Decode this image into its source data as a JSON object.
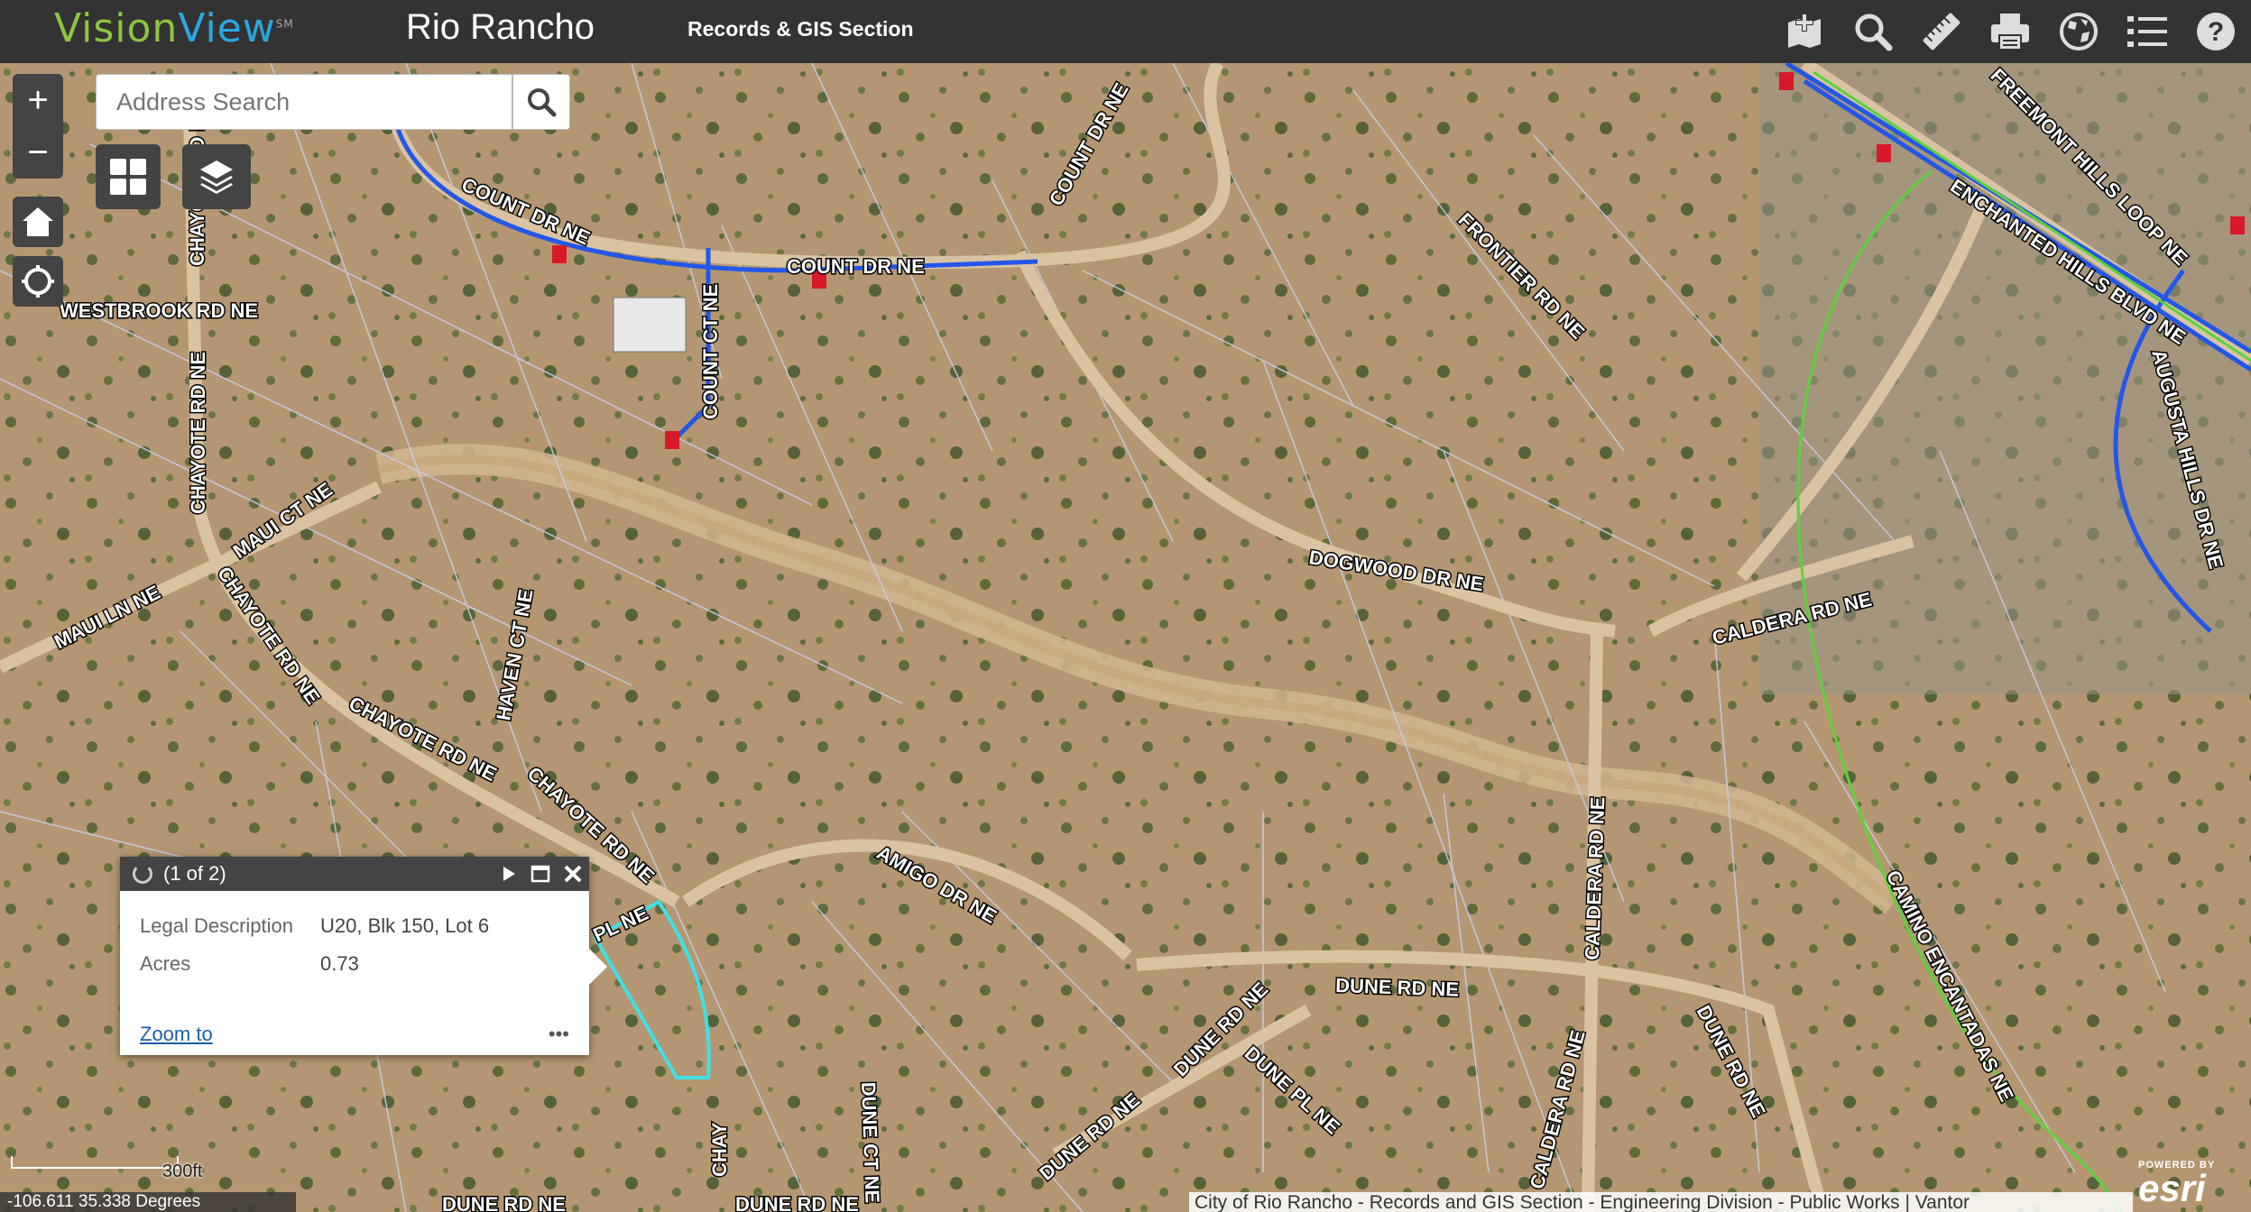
{
  "header": {
    "logo_vision": "Vision",
    "logo_view": "View",
    "logo_mark": "SM",
    "city": "Rio Rancho",
    "section": "Records & GIS Section"
  },
  "toolbar": {
    "icons": [
      "add-data-icon",
      "search-icon",
      "measure-icon",
      "print-icon",
      "basemap-icon",
      "layer-list-icon",
      "help-icon"
    ]
  },
  "map_controls": {
    "zoom_in": "+",
    "zoom_out": "−"
  },
  "search": {
    "placeholder": "Address Search"
  },
  "streets": [
    "COUNT DR NE",
    "COUNT DR NE",
    "COUNT DR NE",
    "COUNT CT NE",
    "WESTBROOK RD NE",
    "CHAYOTE RD NE",
    "CHAYOTE RD NE",
    "CHAYOTE RD NE",
    "CHAYOTE RD NE",
    "CHAYOTE RD NE",
    "MAUI CT NE",
    "MAUI LN NE",
    "HAVEN CT NE",
    "FRONTIER RD NE",
    "FREEMONT HILLS LOOP NE",
    "ENCHANTED HILLS BLVD NE",
    "AUGUSTA HILLS DR NE",
    "DOGWOOD DR NE",
    "CALDERA RD NE",
    "CALDERA RD NE",
    "CALDERA RD NE",
    "AMIGO DR NE",
    "DUNE RD NE",
    "DUNE RD NE",
    "DUNE RD NE",
    "DUNE PL NE",
    "DUNE CT NE",
    "DUNE RD NE",
    "CAMINO ENCANTADAS NE",
    "PL NE",
    "DUNE RD NE",
    "DUNE RD NE",
    "CHAY"
  ],
  "popup": {
    "title": "(1 of 2)",
    "fields": [
      {
        "label": "Legal Description",
        "value": "U20, Blk 150, Lot 6"
      },
      {
        "label": "Acres",
        "value": "0.73"
      }
    ],
    "zoom_link": "Zoom to",
    "more": "•••"
  },
  "scale": {
    "label": "300ft"
  },
  "coordinates": {
    "text": "-106.611 35.338 Degrees"
  },
  "attribution": {
    "text": "City of Rio Rancho - Records and GIS Section - Engineering Division - Public Works | Vantor",
    "powered": "POWERED BY",
    "brand": "esri"
  }
}
